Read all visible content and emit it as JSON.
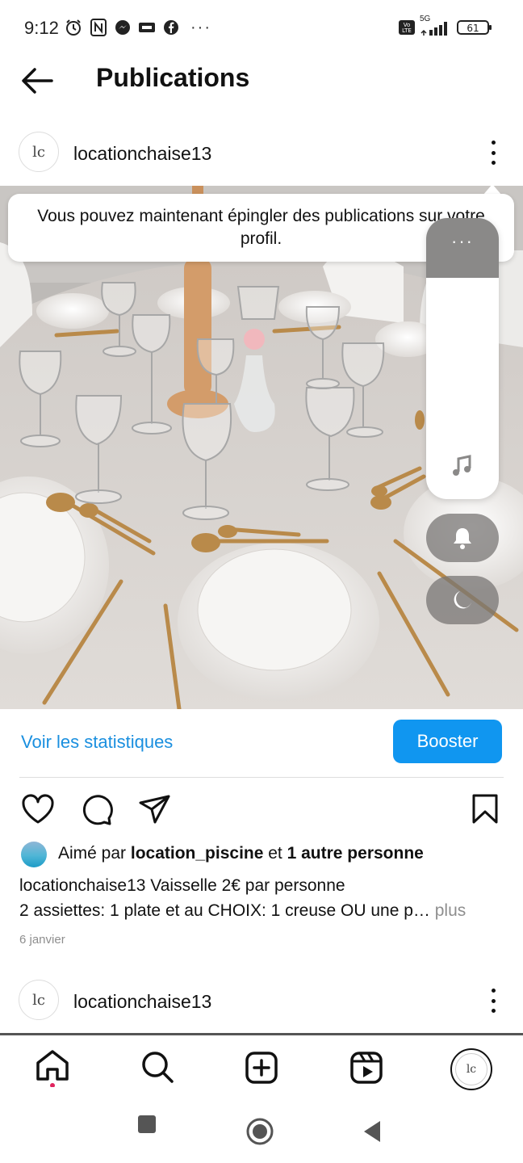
{
  "status_bar": {
    "time": "9:12",
    "network": "5G",
    "volte": "Vo LTE",
    "battery": "61",
    "more": "···"
  },
  "header": {
    "title": "Publications"
  },
  "post": {
    "username": "locationchaise13",
    "avatar_text": "lc",
    "tooltip": "Vous pouvez maintenant épingler des publications sur votre profil.",
    "stats_link": "Voir les statistiques",
    "boost_button": "Booster",
    "liked_prefix": "Aimé par ",
    "liked_user": "location_piscine",
    "liked_and": " et ",
    "liked_others": "1 autre personne",
    "caption_user": "locationchaise13",
    "caption_text": " Vaisselle 2€ par personne",
    "caption_line2": "2 assiettes: 1 plate et au CHOIX: 1 creuse OU une p…",
    "more_label": " plus",
    "date": "6 janvier"
  },
  "next_post": {
    "username": "locationchaise13",
    "avatar_text": "lc"
  },
  "side_panel": {
    "menu_label": "···",
    "icons": [
      "music-icon",
      "bell-icon",
      "moon-icon"
    ]
  },
  "bottom_nav": {
    "items": [
      "home-icon",
      "search-icon",
      "create-icon",
      "reels-icon",
      "profile-icon"
    ]
  },
  "system_nav": {
    "items": [
      "recents-button",
      "home-button",
      "back-button"
    ]
  },
  "colors": {
    "link_blue": "#1a8fdf",
    "boost_blue": "#1096f0",
    "notification_red": "#e0245e"
  }
}
